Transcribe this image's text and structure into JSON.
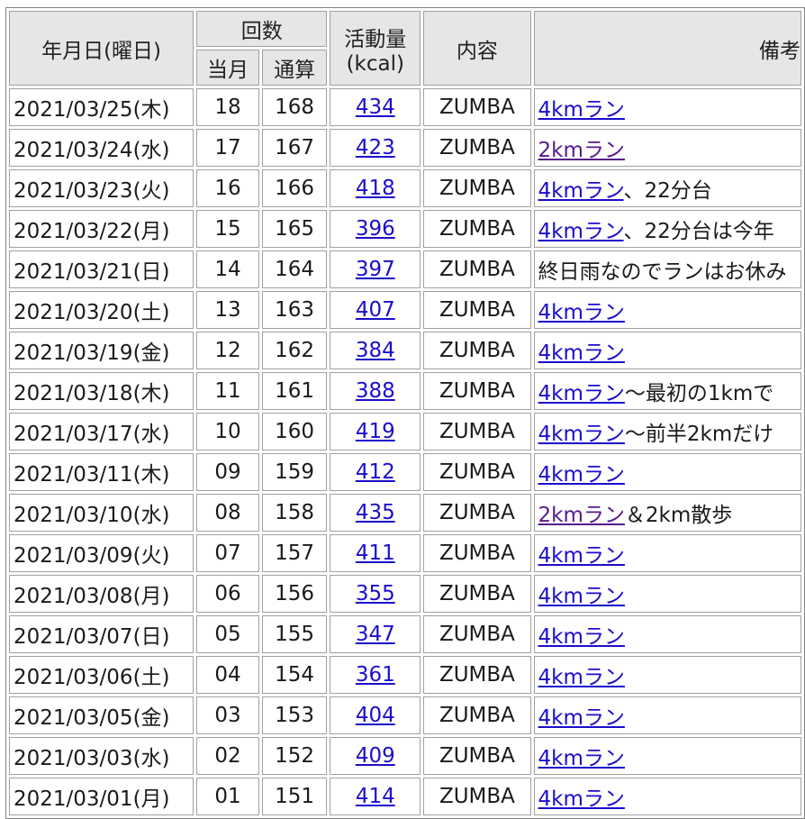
{
  "header": {
    "date": "年月日(曜日)",
    "count": "回数",
    "count_month": "当月",
    "count_total": "通算",
    "activity_line1": "活動量",
    "activity_line2": "(kcal)",
    "content": "内容",
    "remarks": "備考"
  },
  "rows": [
    {
      "date": "2021/03/25(木)",
      "month": "18",
      "total": "168",
      "kcal": "434",
      "content": "ZUMBA",
      "note_link": "4kmラン",
      "note_text": ""
    },
    {
      "date": "2021/03/24(水)",
      "month": "17",
      "total": "167",
      "kcal": "423",
      "content": "ZUMBA",
      "note_link": "2kmラン",
      "note_text": ""
    },
    {
      "date": "2021/03/23(火)",
      "month": "16",
      "total": "166",
      "kcal": "418",
      "content": "ZUMBA",
      "note_link": "4kmラン",
      "note_text": "、22分台"
    },
    {
      "date": "2021/03/22(月)",
      "month": "15",
      "total": "165",
      "kcal": "396",
      "content": "ZUMBA",
      "note_link": "4kmラン",
      "note_text": "、22分台は今年"
    },
    {
      "date": "2021/03/21(日)",
      "month": "14",
      "total": "164",
      "kcal": "397",
      "content": "ZUMBA",
      "note_link": "",
      "note_text": "終日雨なのでランはお休み"
    },
    {
      "date": "2021/03/20(土)",
      "month": "13",
      "total": "163",
      "kcal": "407",
      "content": "ZUMBA",
      "note_link": "4kmラン",
      "note_text": ""
    },
    {
      "date": "2021/03/19(金)",
      "month": "12",
      "total": "162",
      "kcal": "384",
      "content": "ZUMBA",
      "note_link": "4kmラン",
      "note_text": ""
    },
    {
      "date": "2021/03/18(木)",
      "month": "11",
      "total": "161",
      "kcal": "388",
      "content": "ZUMBA",
      "note_link": "4kmラン",
      "note_text": "～最初の1kmで"
    },
    {
      "date": "2021/03/17(水)",
      "month": "10",
      "total": "160",
      "kcal": "419",
      "content": "ZUMBA",
      "note_link": "4kmラン",
      "note_text": "～前半2kmだけ"
    },
    {
      "date": "2021/03/11(木)",
      "month": "09",
      "total": "159",
      "kcal": "412",
      "content": "ZUMBA",
      "note_link": "4kmラン",
      "note_text": ""
    },
    {
      "date": "2021/03/10(水)",
      "month": "08",
      "total": "158",
      "kcal": "435",
      "content": "ZUMBA",
      "note_link": "2kmラン",
      "note_text": "＆2km散歩"
    },
    {
      "date": "2021/03/09(火)",
      "month": "07",
      "total": "157",
      "kcal": "411",
      "content": "ZUMBA",
      "note_link": "4kmラン",
      "note_text": ""
    },
    {
      "date": "2021/03/08(月)",
      "month": "06",
      "total": "156",
      "kcal": "355",
      "content": "ZUMBA",
      "note_link": "4kmラン",
      "note_text": ""
    },
    {
      "date": "2021/03/07(日)",
      "month": "05",
      "total": "155",
      "kcal": "347",
      "content": "ZUMBA",
      "note_link": "4kmラン",
      "note_text": ""
    },
    {
      "date": "2021/03/06(土)",
      "month": "04",
      "total": "154",
      "kcal": "361",
      "content": "ZUMBA",
      "note_link": "4kmラン",
      "note_text": ""
    },
    {
      "date": "2021/03/05(金)",
      "month": "03",
      "total": "153",
      "kcal": "404",
      "content": "ZUMBA",
      "note_link": "4kmラン",
      "note_text": ""
    },
    {
      "date": "2021/03/03(水)",
      "month": "02",
      "total": "152",
      "kcal": "409",
      "content": "ZUMBA",
      "note_link": "4kmラン",
      "note_text": ""
    },
    {
      "date": "2021/03/01(月)",
      "month": "01",
      "total": "151",
      "kcal": "414",
      "content": "ZUMBA",
      "note_link": "4kmラン",
      "note_text": ""
    }
  ],
  "colors": {
    "link": "#1a0dcc",
    "link_visited": "#551a8b",
    "header_bg": "#e6e6e6"
  }
}
